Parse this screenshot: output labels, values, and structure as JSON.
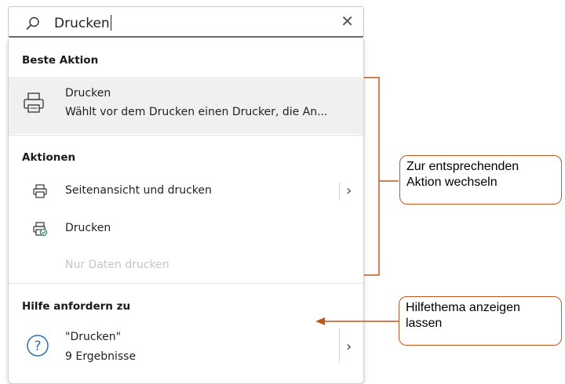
{
  "search": {
    "query": "Drucken",
    "icon": "search-icon",
    "clear_icon": "close-icon",
    "clear_glyph": "✕"
  },
  "best_action": {
    "title": "Beste Aktion",
    "item": {
      "name": "Drucken",
      "description": "Wählt vor dem Drucken einen Drucker, die An...",
      "icon": "printer-icon"
    }
  },
  "actions": {
    "title": "Aktionen",
    "items": [
      {
        "label": "Seitenansicht und drucken",
        "icon": "printer-preview-icon",
        "has_submenu": true,
        "enabled": true
      },
      {
        "label": "Drucken",
        "icon": "printer-check-icon",
        "has_submenu": false,
        "enabled": true
      },
      {
        "label": "Nur Daten drucken",
        "icon": "",
        "has_submenu": false,
        "enabled": false
      }
    ]
  },
  "help": {
    "title": "Hilfe anfordern zu",
    "item": {
      "name": "\"Drucken\"",
      "count": "9 Ergebnisse",
      "icon": "question-icon"
    }
  },
  "chevron_glyph": "›",
  "annotations": [
    {
      "lines": [
        "Zur entsprechenden",
        "Aktion wechseln"
      ]
    },
    {
      "lines": [
        "Hilfethema anzeigen",
        "lassen"
      ]
    }
  ],
  "colors": {
    "accent_annotation": "#c0571f",
    "highlight_row": "#f0f0f0",
    "disabled_text": "#c4c4c4",
    "check_green": "#2e8b57",
    "help_icon_blue": "#2a72b5"
  }
}
